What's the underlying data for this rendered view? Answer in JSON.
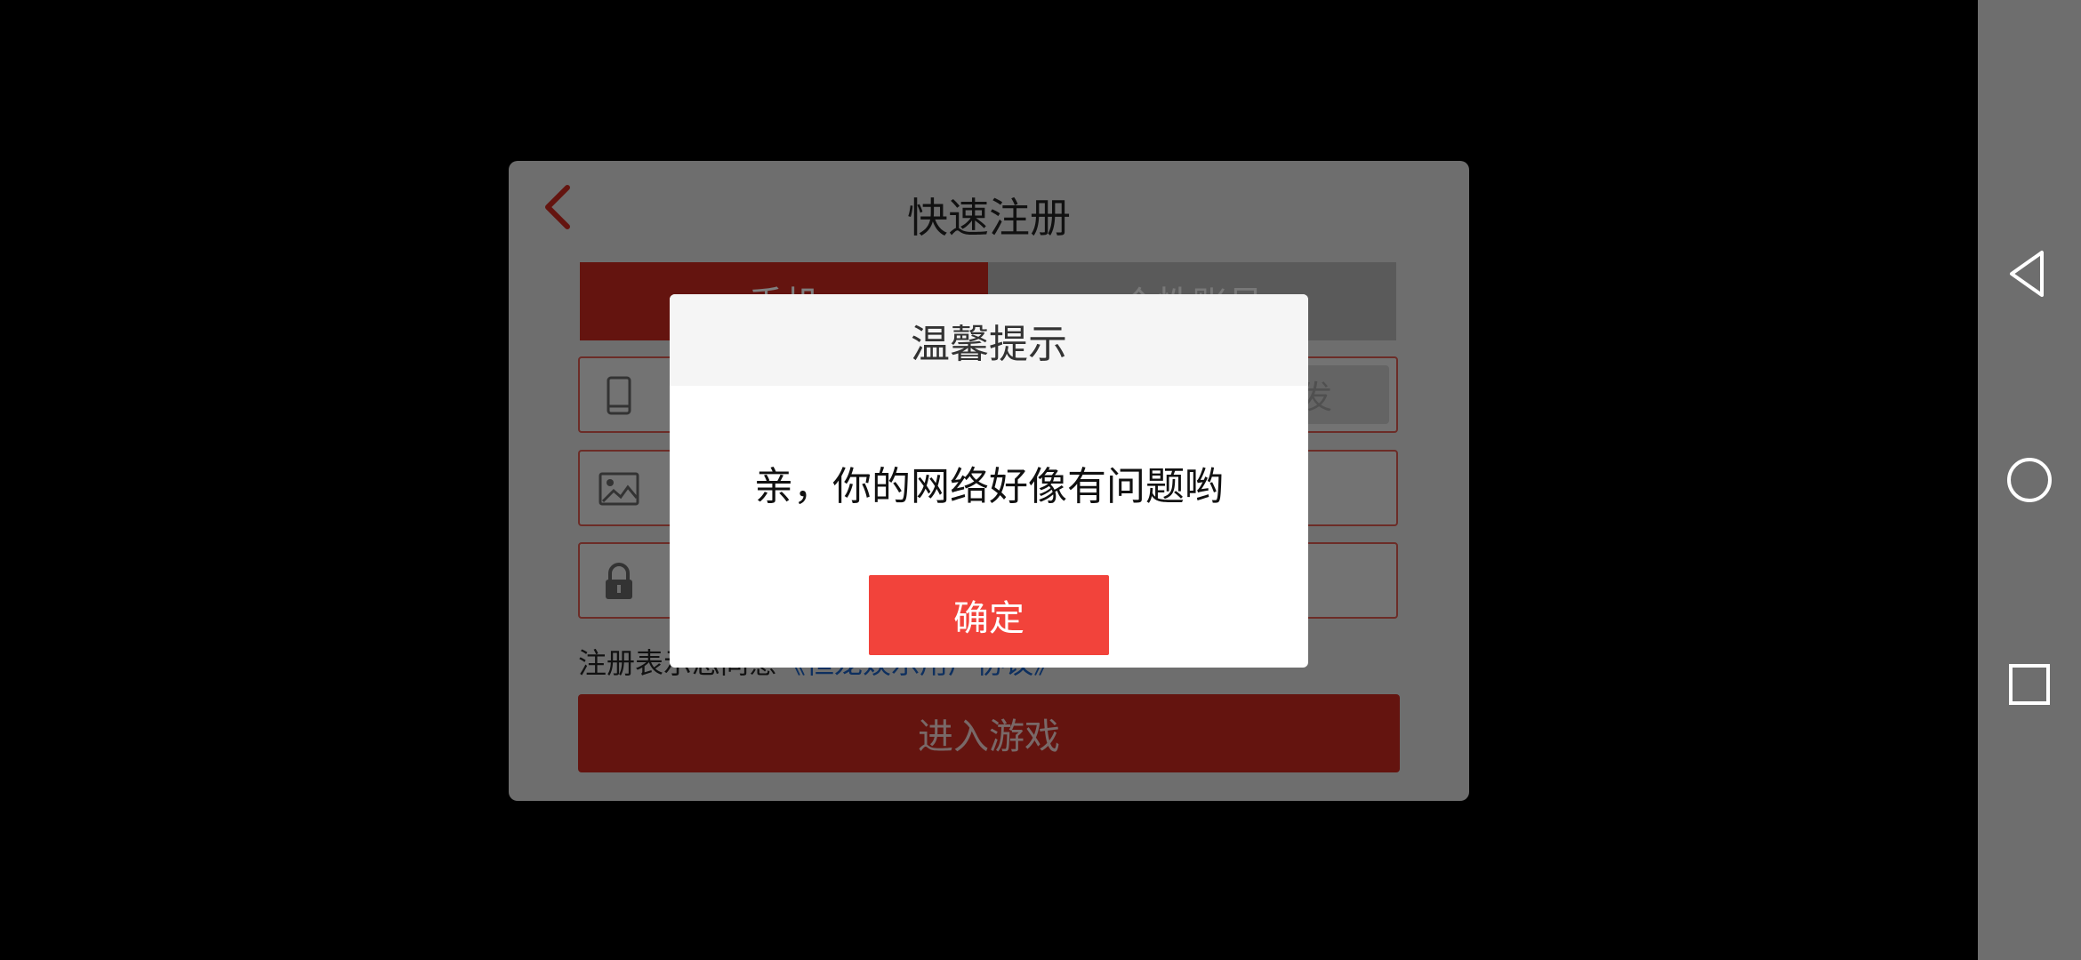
{
  "panel": {
    "title": "快速注册",
    "tabs": [
      {
        "label": "手机",
        "active": true
      },
      {
        "label": "个性账号",
        "active": false
      }
    ],
    "phone_field": {
      "resend_label": "重发"
    },
    "agreement": {
      "prefix": "注册表示您同意",
      "link": "《恒龙娱乐用户协议》"
    },
    "enter_button": "进入游戏"
  },
  "dialog": {
    "title": "温馨提示",
    "message": "亲，你的网络好像有问题哟",
    "ok_label": "确定"
  },
  "colors": {
    "brand_red": "#c8281e",
    "dialog_button": "#f2433b",
    "link": "#1a5fbf"
  },
  "icons": {
    "back": "chevron-left-icon",
    "phone": "phone-icon",
    "image": "image-icon",
    "lock": "lock-icon",
    "nav_back": "triangle-back-icon",
    "nav_home": "circle-home-icon",
    "nav_recents": "square-recents-icon"
  }
}
